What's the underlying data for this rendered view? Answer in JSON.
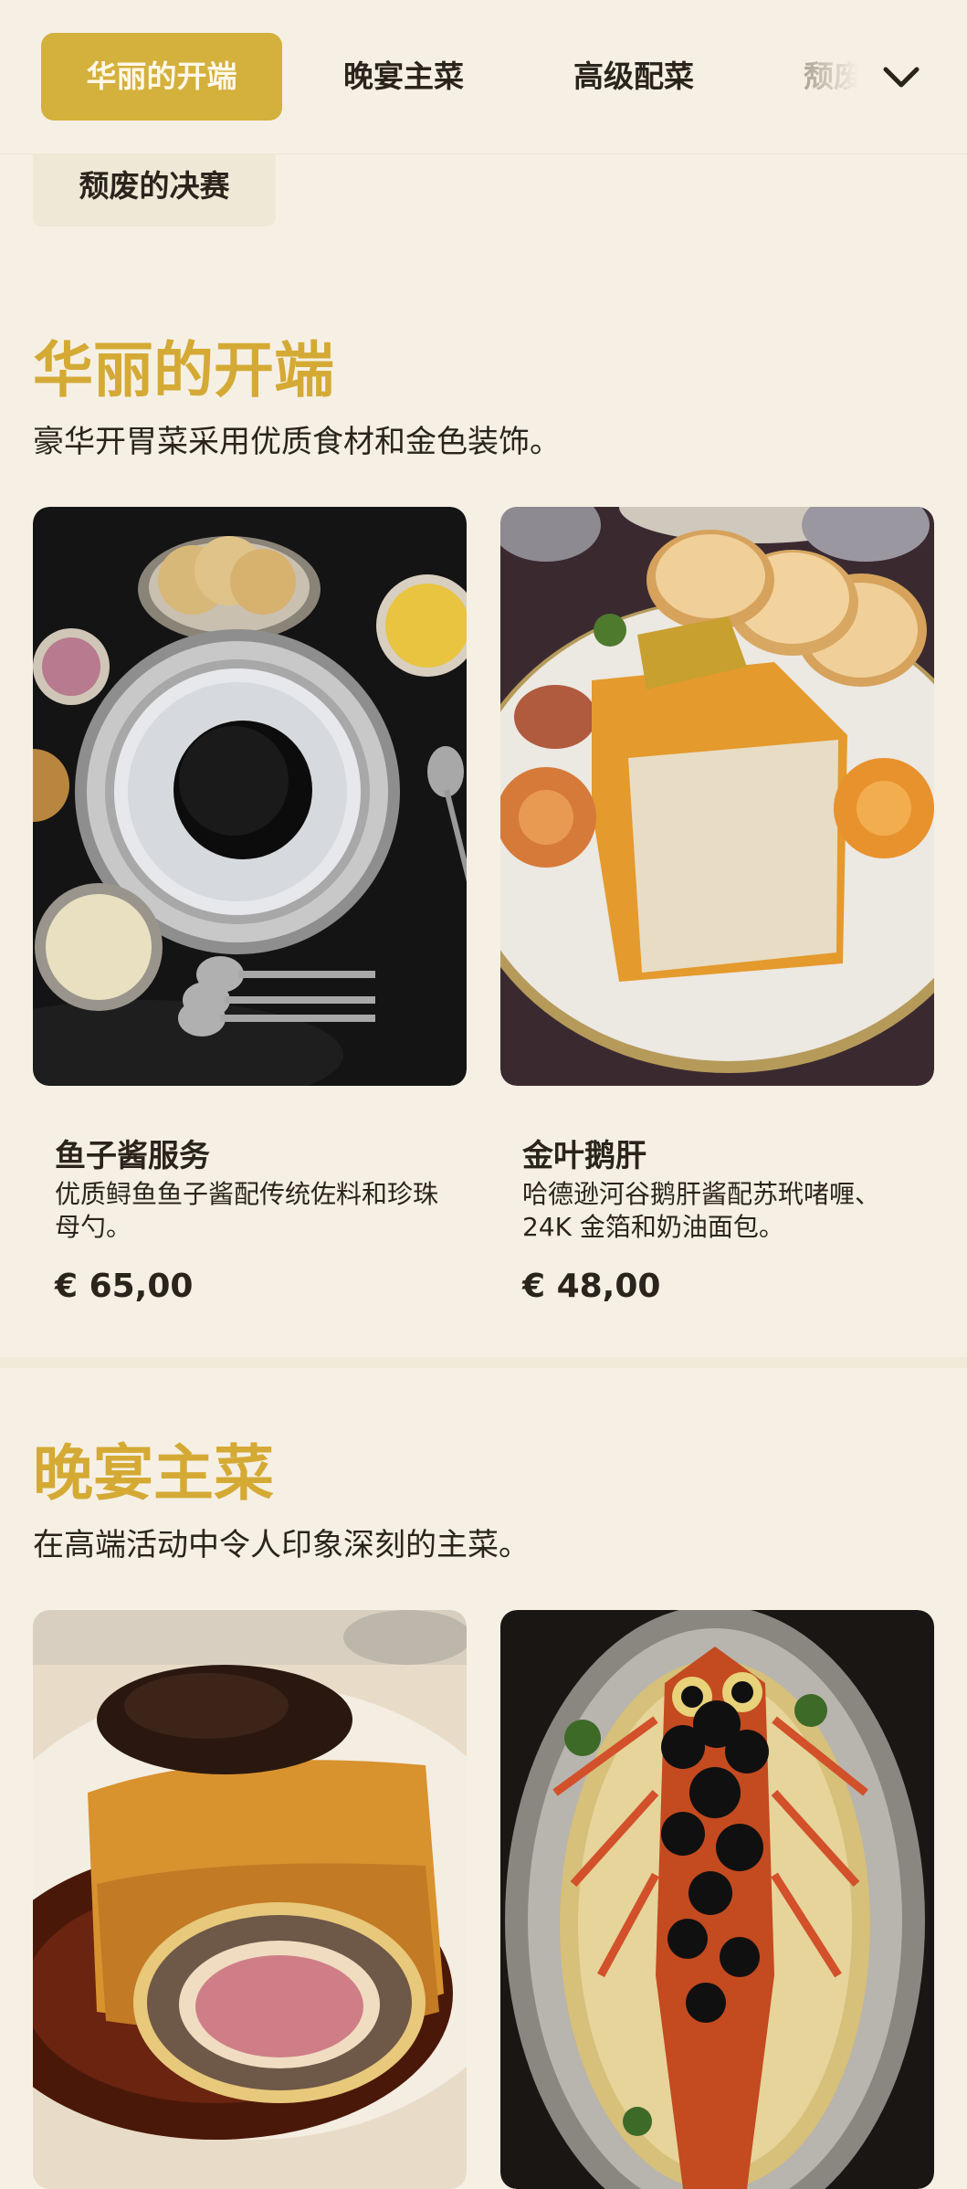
{
  "tabs": {
    "items": [
      "华丽的开端",
      "晚宴主菜",
      "高级配菜",
      "颓废"
    ],
    "overflow_item": "颓废的决赛",
    "active_index": 0
  },
  "sections": [
    {
      "title": "华丽的开端",
      "description": "豪华开胃菜采用优质食材和金色装饰。",
      "items": [
        {
          "name": "鱼子酱服务",
          "description": "优质鲟鱼鱼子酱配传统佐料和珍珠母勺。",
          "price": "€ 65,00",
          "image": "caviar-service-photo"
        },
        {
          "name": "金叶鹅肝",
          "description": "哈德逊河谷鹅肝酱配苏玳啫喱、24K 金箔和奶油面包。",
          "price": "€ 48,00",
          "image": "gold-leaf-foie-gras-photo"
        }
      ]
    },
    {
      "title": "晚宴主菜",
      "description": "在高端活动中令人印象深刻的主菜。",
      "items": [
        {
          "name": "",
          "description": "",
          "price": "",
          "image": "beef-wellington-photo"
        },
        {
          "name": "",
          "description": "",
          "price": "",
          "image": "lobster-truffle-photo"
        }
      ]
    }
  ],
  "colors": {
    "accent": "#d4b03c",
    "title": "#d4aa35",
    "background": "#f6f0e4",
    "text": "#2a241c"
  },
  "icons": {
    "expand": "chevron-down-icon"
  }
}
